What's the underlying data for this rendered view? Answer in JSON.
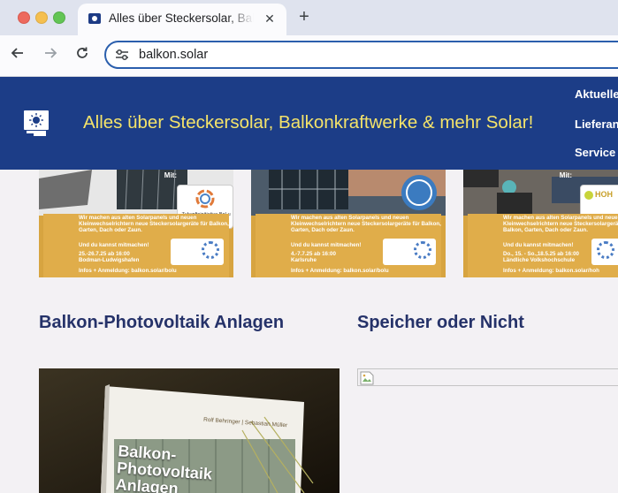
{
  "browser": {
    "tab_title": "Alles über Steckersolar, Balkonkraftwerke & mehr Solar!",
    "url": "balkon.solar",
    "new_tab_symbol": "+",
    "close_symbol": "✕"
  },
  "site": {
    "title": "Alles über Steckersolar, Balkonkraftwerke & mehr Solar!",
    "nav": [
      "Aktuelles",
      "Lieferant",
      "Service &"
    ]
  },
  "banners": [
    {
      "partner": "Zukunftsinitiative BoLu",
      "mit": "Mit:",
      "intro": "Wir machen aus alten Solarpanels und neuen Kleinwechselrichtern neue Steckersolargeräte für Balkon, Garten, Dach oder Zaun.",
      "cta": "Und du kannst mitmachen!",
      "date": "25.-26.7.25 ab 16:00",
      "place": "Bodman-Ludwigshafen",
      "info": "Infos + Anmeldung: balkon.solar/bolu"
    },
    {
      "partner": "",
      "mit": "",
      "intro": "Wir machen aus alten Solarpanels und neuen Kleinwechselrichtern neue Steckersolargeräte für Balkon, Garten, Dach oder Zaun.",
      "cta": "Und du kannst mitmachen!",
      "date": "4.-7.7.25 ab 16:00",
      "place": "Karlsruhe",
      "info": "Infos + Anmeldung: balkon.solar/bolu"
    },
    {
      "partner": "HOH",
      "mit": "Mit:",
      "intro": "Wir machen aus alten Solarpanels und neuen Kleinwechselrichtern neue Steckersolargeräte für Balkon, Garten, Dach oder Zaun.",
      "cta": "Und du kannst mitmachen!",
      "date": "Do., 15. - So.,18.5.25 ab 16:00",
      "place": "Ländliche Volkshochschule",
      "info": "Infos + Anmeldung: balkon.solar/hoh"
    }
  ],
  "sections": {
    "left_title": "Balkon-Photovoltaik Anlagen",
    "right_title": "Speicher oder Nicht"
  },
  "book": {
    "authors": "Rolf Behringer | Sebastian Müller",
    "title_lines": [
      "Balkon-",
      "Photovoltaik",
      "Anlagen"
    ]
  },
  "colors": {
    "header_bg": "#1c3d87",
    "title_yellow": "#f4e36a",
    "heading": "#253269",
    "banner_gold": "#e0ad4a"
  }
}
